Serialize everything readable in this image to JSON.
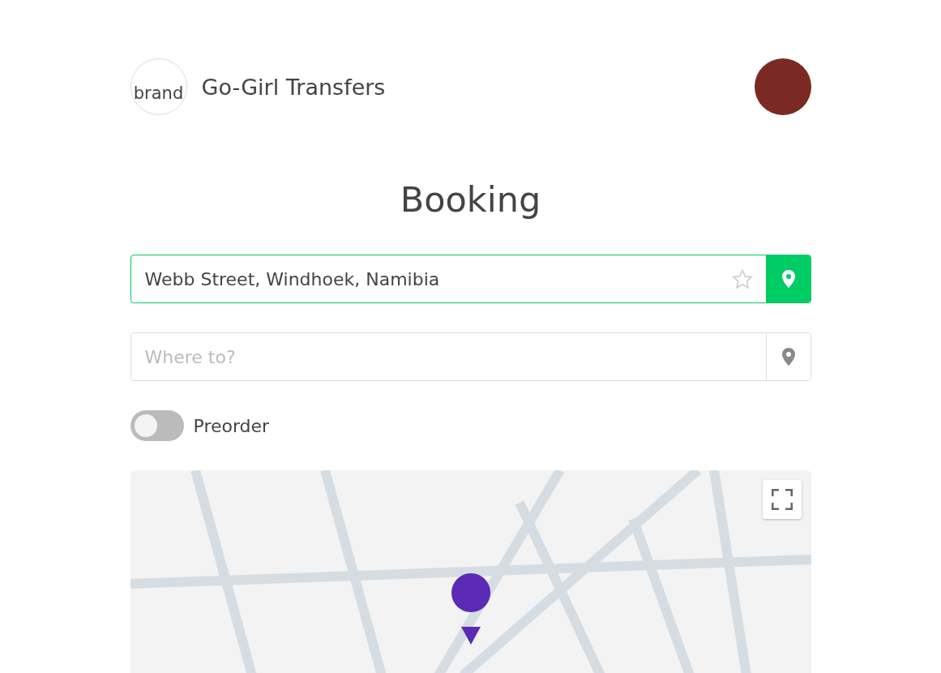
{
  "header": {
    "brand_alt": "brand",
    "title": "Go-Girl Transfers"
  },
  "heading": "Booking",
  "pickup": {
    "value": "Webb Street, Windhoek, Namibia",
    "active": true
  },
  "destination": {
    "placeholder": "Where to?",
    "active": false
  },
  "preorder": {
    "label": "Preorder",
    "on": false
  }
}
